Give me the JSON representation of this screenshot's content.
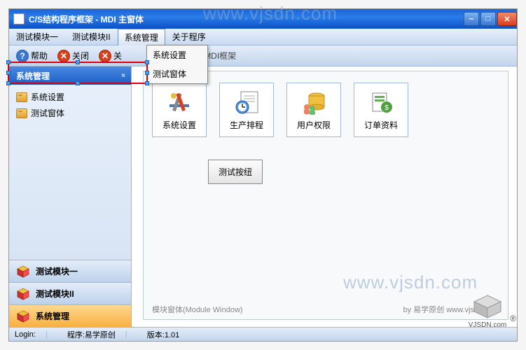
{
  "window": {
    "title": "C/S结构程序框架 - MDI 主窗体"
  },
  "menu": {
    "items": [
      "测试模块一",
      "测试模块II",
      "系统管理",
      "关于程序"
    ],
    "activeIndex": 2,
    "dropdown": [
      "系统设置",
      "测试窗体"
    ]
  },
  "toolbar": {
    "help": "帮助",
    "close": "关闭",
    "closeShort": "关",
    "trailing": "oolbar | 参考MDI框架"
  },
  "sidebar": {
    "header": "系统管理",
    "tree": [
      "系统设置",
      "测试窗体"
    ],
    "nav": [
      "测试模块一",
      "测试模块II",
      "系统管理"
    ],
    "activeNavIndex": 2
  },
  "mdi": {
    "cards": [
      "系统设置",
      "生产排程",
      "用户权限",
      "订单资料"
    ],
    "testButton": "测试按纽",
    "footerLeft": "模块窗体(Module Window)",
    "footerRight": "by 易学原创 www.vjsdn.com"
  },
  "status": {
    "login": "Login:",
    "program": "程序:易学原创",
    "version": "版本:1.01"
  },
  "watermark": "www.vjsdn.com",
  "logo": "VJSDN.com"
}
